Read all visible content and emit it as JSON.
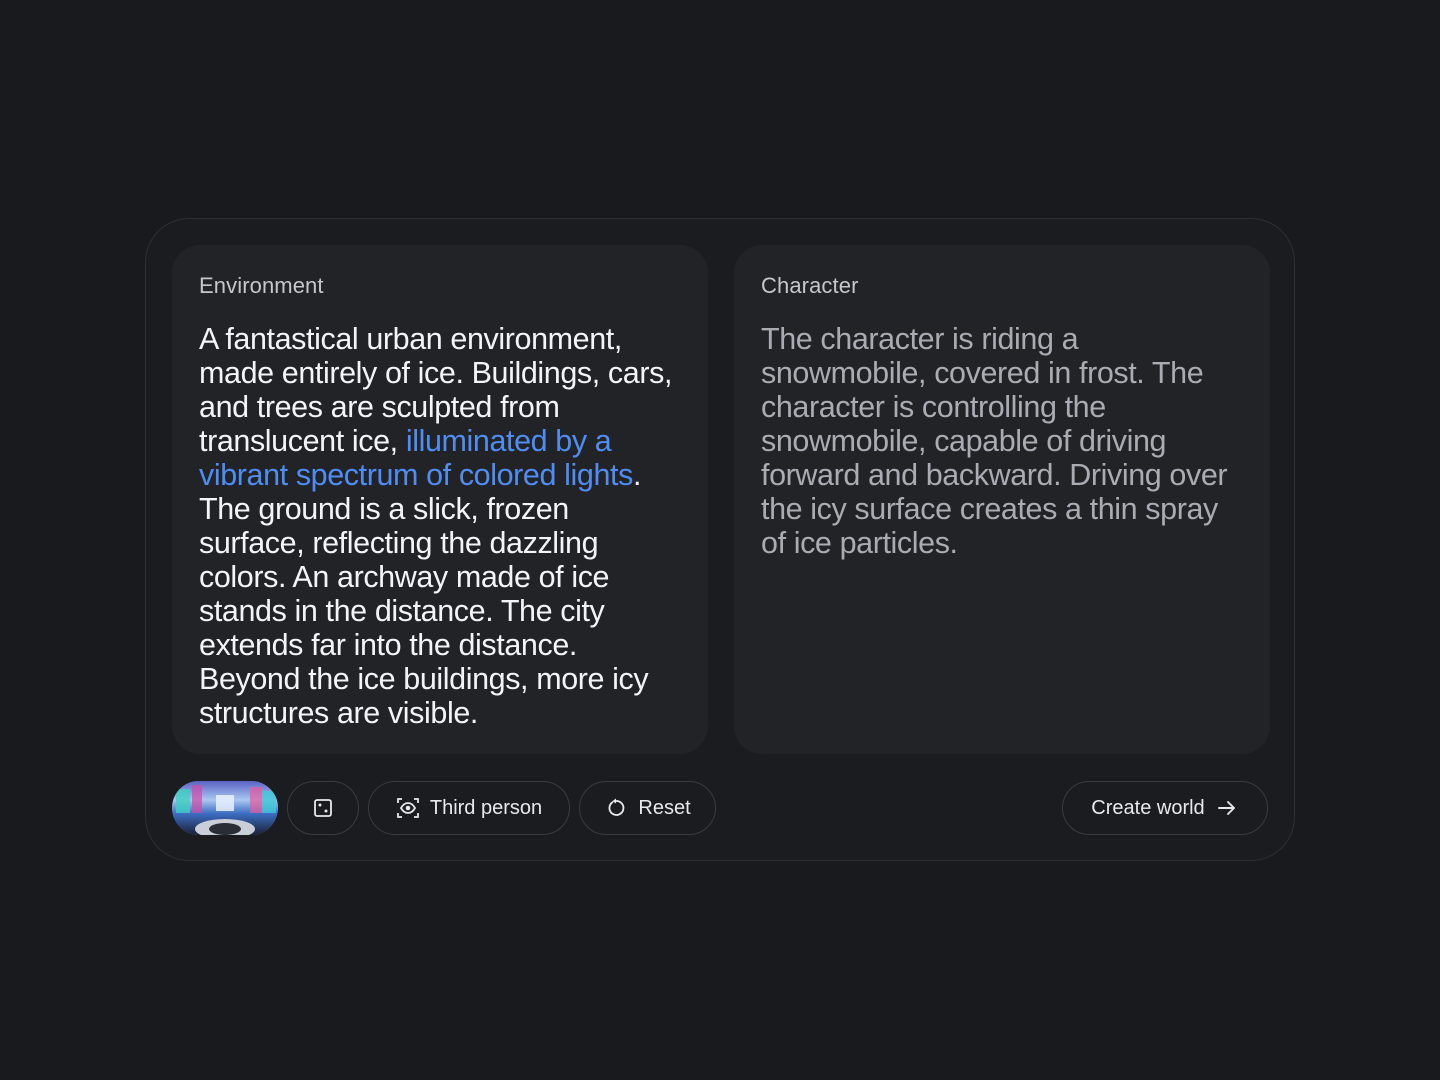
{
  "environment": {
    "label": "Environment",
    "text_before": "A fantastical urban environment, made entirely of ice. Buildings, cars, and trees are sculpted from translucent ice, ",
    "text_highlight": "illuminated by a vibrant spectrum of colored lights",
    "text_after": ". The ground is a slick, frozen surface, reflecting the dazzling colors. An archway made of ice stands in the distance. The city extends far into the distance. Beyond the ice buildings, more icy structures are visible."
  },
  "character": {
    "label": "Character",
    "text": "The character is riding a snowmobile, covered in frost. The character is controlling the snowmobile, capable of driving forward and backward. Driving over the icy surface creates a thin spray of ice particles."
  },
  "toolbar": {
    "dice_icon": "dice-icon",
    "third_person_icon": "eye-viewfinder-icon",
    "third_person_label": "Third person",
    "reset_icon": "reset-icon",
    "reset_label": "Reset",
    "create_label": "Create world",
    "create_icon": "arrow-right-icon"
  },
  "colors": {
    "background": "#191a1e",
    "panel": "#222327",
    "highlight": "#4f8df3"
  }
}
